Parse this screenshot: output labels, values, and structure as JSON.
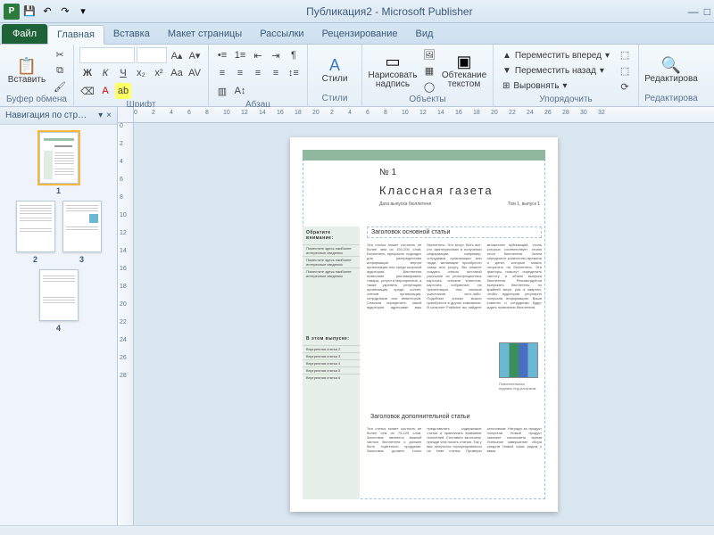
{
  "titlebar": {
    "title": "Публикация2 - Microsoft Publisher"
  },
  "qat": {
    "save": "💾",
    "undo": "↶",
    "redo": "↷"
  },
  "tabs": {
    "file": "Файл",
    "items": [
      "Главная",
      "Вставка",
      "Макет страницы",
      "Рассылки",
      "Рецензирование",
      "Вид"
    ],
    "active": 0
  },
  "ribbon": {
    "clipboard": {
      "label": "Буфер обмена",
      "paste": "Вставить"
    },
    "font": {
      "label": "Шрифт"
    },
    "paragraph": {
      "label": "Абзац"
    },
    "styles": {
      "label": "Стили",
      "btn": "Стили"
    },
    "objects": {
      "label": "Объекты",
      "draw_text": "Нарисовать\nнадпись",
      "wrap": "Обтекание\nтекстом"
    },
    "arrange": {
      "label": "Упорядочить",
      "bring_forward": "Переместить вперед",
      "send_backward": "Переместить назад",
      "align": "Выровнять"
    },
    "editing": {
      "label": "Редактирова",
      "btn": "Редактирова"
    }
  },
  "nav": {
    "title": "Навигация по стр…",
    "pages": [
      "1",
      "2",
      "3",
      "4"
    ]
  },
  "ruler_h": [
    "0",
    "2",
    "4",
    "6",
    "8",
    "10",
    "12",
    "14",
    "16",
    "18",
    "20",
    "2",
    "4",
    "6",
    "8",
    "10",
    "12",
    "14",
    "16",
    "18",
    "20",
    "22",
    "24",
    "26",
    "28",
    "30",
    "32"
  ],
  "ruler_v": [
    "0",
    "2",
    "4",
    "6",
    "8",
    "10",
    "12",
    "14",
    "16",
    "18",
    "20",
    "22",
    "24",
    "26",
    "28"
  ],
  "doc": {
    "issue": "№ 1",
    "title": "Классная газета",
    "sub_left": "Дата выпуска бюллетеня",
    "sub_right": "Том 1, выпуск 1",
    "headline1": "Заголовок основной статьи",
    "headline2": "Заголовок дополнительной статьи",
    "side_head1": "Обратите внимание:",
    "side_bullets": [
      "Поместите здесь наиболее интересные сведения",
      "Поместите здесь наиболее интересные сведения",
      "Поместите здесь наиболее интересные сведения"
    ],
    "side_head2": "В этом выпуске:",
    "toc": [
      "Внутренняя статья  2",
      "Внутренняя статья  3",
      "Внутренняя статья  4",
      "Внутренняя статья  5",
      "Внутренняя статья  6"
    ],
    "body": "Эта статья может состоять не более чем из 150-200 слов. Бюллетень прекрасно подходит для распределения информации внутри организации или среди широкой аудитории. Бюллетени позволяют рекламировать товары, услуги и мероприятия, а также укрепить репутацию организации среди коллег, членов организации, сотрудников или инвесторов. Сначала определите, какой аудитории адресован ваш бюллетень. Это могут быть все, кто заинтересован в получении информации: например, сотрудники организации или люди, желающие приобрести товар или услугу. Вы можете создать список почтовой рассылки из регистрационных карточек, списков клиентов, карточек, собранных на презентации, или списков участников чего-либо. Подобные списки можно приобрести в других компаниях. В каталоге Publisher вы найдете множество публикаций, стиль которых соответствует стилю этого бюллетеня. Затем определите количество времени и денег, которые можно потратить на бюллетень. Эти факторы помогут определить частоту и объем выпуска бюллетеня. Рекомендуется выпускать бюллетень, по крайней мере, раз в квартал, чтобы аудитория регулярно получала информацию. Ваши клиенты и сотрудники будут ждать появления бюллетеня.",
    "caption": "Пояснительная подпись под рисунком",
    "body2": "Эта статья может состоять не более чем из 75-125 слов. Заголовок является важной частью бюллетеня и должен быть тщательно продуман. Заголовок должен точно представлять содержимое статьи и привлекать внимание читателей. Составьте заголовок, прежде чем писать статью. Так у вас получится сфокусироваться на теме статьи. Примеры заголовков: Награда за продукт получена Новый продукт поможет сэкономить время Успешное завершение сбора средств Новый офис рядом с вами."
  }
}
